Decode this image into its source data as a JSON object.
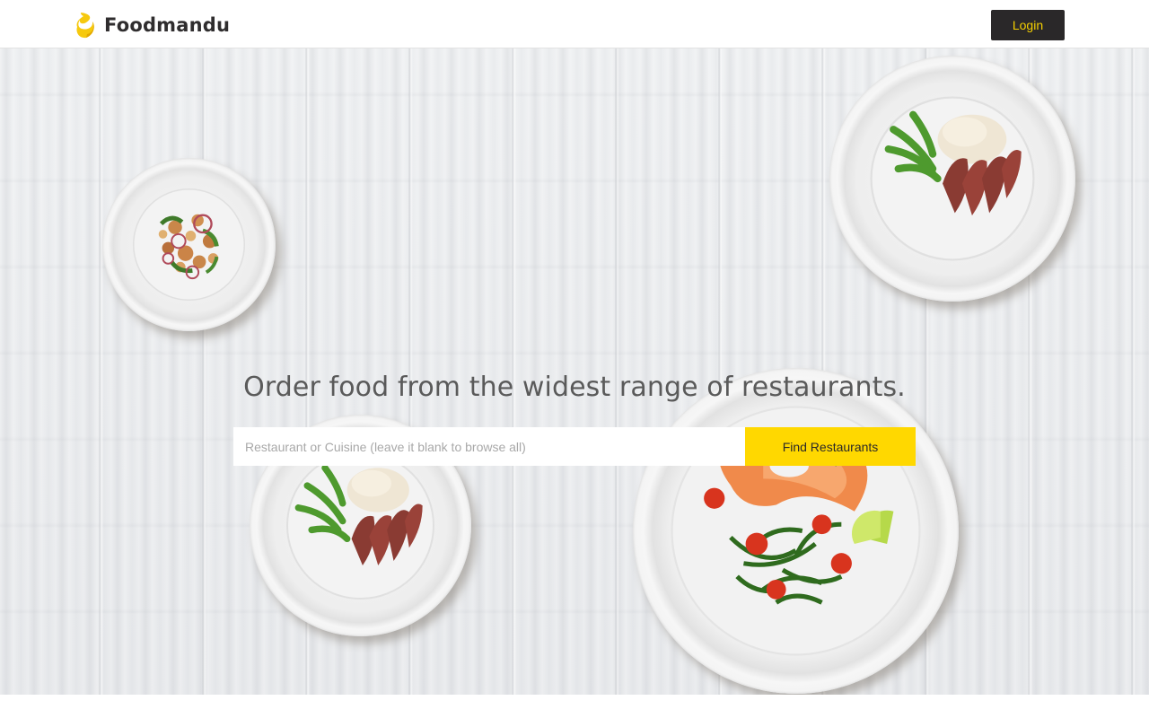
{
  "header": {
    "brand": "Foodmandu",
    "login_label": "Login"
  },
  "hero": {
    "headline": "Order food from the widest range of restaurants.",
    "search_placeholder": "Restaurant or Cuisine (leave it blank to browse all)",
    "search_value": "",
    "find_button_label": "Find Restaurants"
  },
  "icons": {
    "logo": "foodmandu-flame-icon"
  },
  "colors": {
    "accent": "#ffd800",
    "dark": "#2a2829",
    "login_text": "#f5d000",
    "headline": "#5a5a5a"
  }
}
